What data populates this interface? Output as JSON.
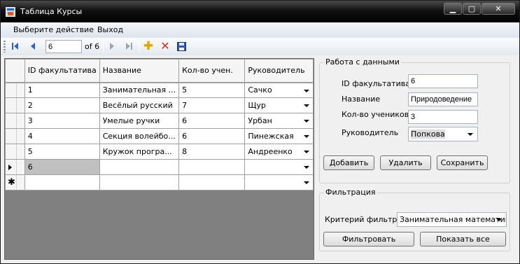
{
  "window": {
    "title": "Таблица Курсы"
  },
  "menu": {
    "items": [
      "Выберите действие",
      "Выход"
    ]
  },
  "navigator": {
    "position": "6",
    "count_label": "of 6"
  },
  "grid": {
    "columns": [
      "ID факультатива",
      "Название",
      "Кол-во учен.",
      "Руководитель"
    ],
    "rows": [
      {
        "id": "1",
        "name": "Занимательная ...",
        "count": "5",
        "leader": "Сачко"
      },
      {
        "id": "2",
        "name": "Весёлый русский",
        "count": "7",
        "leader": "Щур"
      },
      {
        "id": "3",
        "name": "Умелые ручки",
        "count": "6",
        "leader": "Урбан"
      },
      {
        "id": "4",
        "name": "Секция волейбо...",
        "count": "6",
        "leader": "Пинежская"
      },
      {
        "id": "5",
        "name": "Кружок програ...",
        "count": "8",
        "leader": "Андреенко"
      },
      {
        "id": "6",
        "name": "",
        "count": "",
        "leader": ""
      },
      {
        "id": "",
        "name": "",
        "count": "",
        "leader": ""
      }
    ]
  },
  "data_panel": {
    "title": "Работа с данными",
    "id_label": "ID факультатива",
    "id_value": "6",
    "name_label": "Название",
    "name_value": "Природоведение",
    "count_label": "Кол-во учеников",
    "count_value": "3",
    "leader_label": "Руководитель",
    "leader_value": "Попкова",
    "add_button": "Добавить",
    "delete_button": "Удалить",
    "save_button": "Сохранить"
  },
  "filter_panel": {
    "title": "Фильтрация",
    "criteria_label": "Критерий фильтра",
    "criteria_value": "Занимательная математика",
    "filter_button": "Фильтровать",
    "show_all_button": "Показать все"
  },
  "colors": {
    "titlebar": "#000000",
    "grid_background": "#808080",
    "current_cell": "#c0c0c0",
    "nav_blue": "#2f63c7"
  }
}
